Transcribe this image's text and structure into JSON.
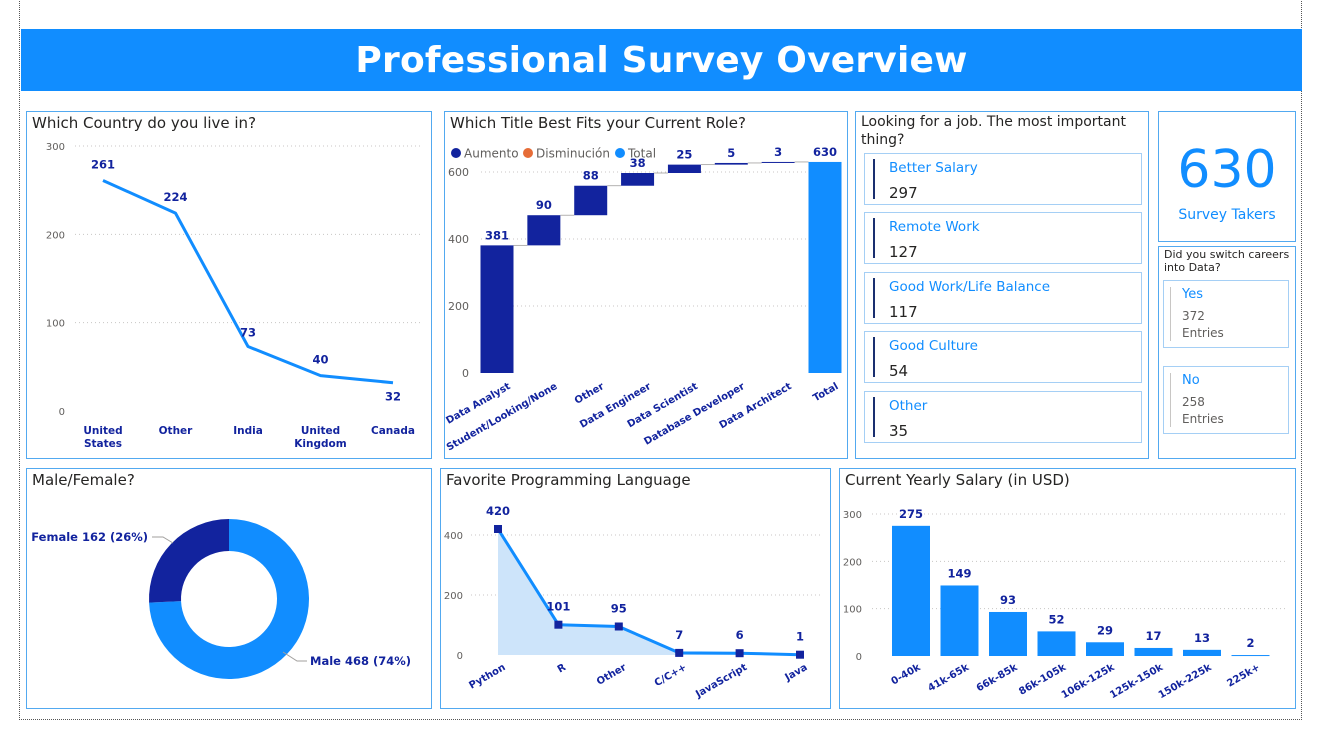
{
  "header": {
    "title": "Professional Survey Overview"
  },
  "colors": {
    "primary": "#118DFF",
    "dark": "#12239E",
    "decrease": "#E66C37",
    "area": "#CDE4FA"
  },
  "country": {
    "title": "Which Country do you live in?",
    "chart_data": {
      "type": "line",
      "categories": [
        "United States",
        "Other",
        "India",
        "United Kingdom",
        "Canada"
      ],
      "category_lines": [
        [
          "United",
          "States"
        ],
        [
          "Other"
        ],
        [
          "India"
        ],
        [
          "United",
          "Kingdom"
        ],
        [
          "Canada"
        ]
      ],
      "values": [
        261,
        224,
        73,
        40,
        32
      ],
      "yticks": [
        0,
        100,
        200,
        300
      ],
      "ylim": [
        0,
        300
      ]
    }
  },
  "role": {
    "title": "Which Title Best Fits your Current Role?",
    "legend": [
      "Aumento",
      "Disminución",
      "Total"
    ],
    "chart_data": {
      "type": "bar",
      "subtype": "waterfall",
      "categories": [
        "Data Analyst",
        "Student/Looking/None",
        "Other",
        "Data Engineer",
        "Data Scientist",
        "Database Developer",
        "Data Architect",
        "Total"
      ],
      "values": [
        381,
        90,
        88,
        38,
        25,
        5,
        3,
        630
      ],
      "yticks": [
        0,
        200,
        400,
        600
      ],
      "ylim": [
        0,
        650
      ]
    }
  },
  "job": {
    "title_lines": [
      "Looking for a job. The most important",
      "thing?"
    ],
    "cards": [
      {
        "label": "Better Salary",
        "value": "297"
      },
      {
        "label": "Remote Work",
        "value": "127"
      },
      {
        "label": "Good Work/Life Balance",
        "value": "117"
      },
      {
        "label": "Good Culture",
        "value": "54"
      },
      {
        "label": "Other",
        "value": "35"
      }
    ]
  },
  "kpi": {
    "value": "630",
    "label": "Survey Takers"
  },
  "switch": {
    "title_lines": [
      "Did you switch careers",
      "into Data?"
    ],
    "cards": [
      {
        "label": "Yes",
        "value": "372",
        "sub": "Entries"
      },
      {
        "label": "No",
        "value": "258",
        "sub": "Entries"
      }
    ]
  },
  "gender": {
    "title": "Male/Female?",
    "chart_data": {
      "type": "pie",
      "subtype": "donut",
      "slices": [
        {
          "label": "Male 468 (74%)",
          "value": 468
        },
        {
          "label": "Female 162 (26%)",
          "value": 162
        }
      ]
    }
  },
  "language": {
    "title": "Favorite Programming Language",
    "chart_data": {
      "type": "area",
      "categories": [
        "Python",
        "R",
        "Other",
        "C/C++",
        "JavaScript",
        "Java"
      ],
      "values": [
        420,
        101,
        95,
        7,
        6,
        1
      ],
      "yticks": [
        0,
        200,
        400
      ],
      "ylim": [
        0,
        450
      ]
    }
  },
  "salary": {
    "title": "Current Yearly Salary (in USD)",
    "chart_data": {
      "type": "bar",
      "categories": [
        "0-40k",
        "41k-65k",
        "66k-85k",
        "86k-105k",
        "106k-125k",
        "125k-150k",
        "150k-225k",
        "225k+"
      ],
      "values": [
        275,
        149,
        93,
        52,
        29,
        17,
        13,
        2
      ],
      "yticks": [
        0,
        100,
        200,
        300
      ],
      "ylim": [
        0,
        300
      ]
    }
  }
}
